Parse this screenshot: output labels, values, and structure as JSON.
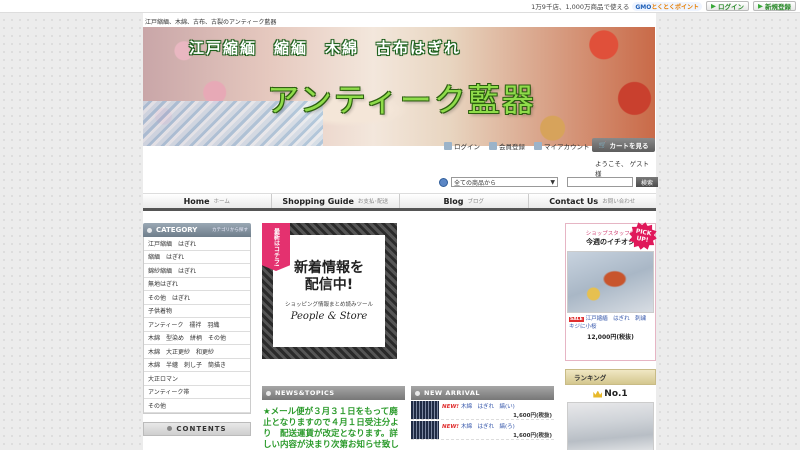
{
  "topbar": {
    "promo_text": "1万9千店、1,000万商品で使える",
    "gmo_brand": "GMO",
    "gmo_points": "とくとくポイント",
    "login_label": "ログイン",
    "register_label": "新規登録"
  },
  "header": {
    "tagline": "江戸縮緬、木綿、古布、古裂のアンティーク藍器",
    "banner_sub": "江戸縮緬　縮緬　木綿　古布はぎれ",
    "banner_main": "アンティーク藍器"
  },
  "member": {
    "login": "ログイン",
    "register": "会員登録",
    "account": "マイアカウント",
    "cart": "カートを見る",
    "welcome": "ようこそ、 ゲスト 様"
  },
  "search": {
    "select_value": "全ての商品から",
    "button": "検索"
  },
  "nav": [
    {
      "en": "Home",
      "jp": "ホーム"
    },
    {
      "en": "Shopping Guide",
      "jp": "お支払･配送"
    },
    {
      "en": "Blog",
      "jp": "ブログ"
    },
    {
      "en": "Contact Us",
      "jp": "お問い合わせ"
    }
  ],
  "sidebar": {
    "category_title": "CATEGORY",
    "category_sub": "カテゴリから探す",
    "categories": [
      "江戸縮緬　はぎれ",
      "縮緬　はぎれ",
      "錦紗縮緬　はぎれ",
      "無地はぎれ",
      "その他　はぎれ",
      "子供着物",
      "アンティーク　襦袢　羽織",
      "木綿　型染め　絣柄　その他",
      "木綿　大正更紗　和更紗",
      "木綿　半纏　刺し子　筒描き",
      "大正ロマン",
      "アンティーク帯",
      "その他"
    ],
    "contents_title": "CONTENTS"
  },
  "ad": {
    "badge": "最新はコチラ!",
    "line1": "新着情報を",
    "line2": "配信中!",
    "line3": "ショッピング情報まとめ読みツール",
    "brand": "People & Store"
  },
  "news": {
    "title": "NEWS&TOPICS",
    "body": "★メール便が３月３１日をもって廃止となりますので４月１日受注分より　配送運賃が改定となります。詳しい内容が決まり次第お知らせ致し"
  },
  "arrival": {
    "title": "NEW ARRIVAL",
    "items": [
      {
        "new": "NEW!",
        "name": "木綿　はぎれ　縞(い)",
        "price": "1,600円(税抜)"
      },
      {
        "new": "NEW!",
        "name": "木綿　はぎれ　縞(ろ)",
        "price": "1,600円(税抜)"
      }
    ]
  },
  "pickup": {
    "head_small": "ショップスタッフの",
    "head_main": "今週のイチオシ",
    "badge": "PICK UP!",
    "sale": "SALE",
    "name": "江戸縮緬　はぎれ　刺繍　キジに小桜",
    "price": "12,000円(税抜)"
  },
  "ranking": {
    "title": "ランキング",
    "no1": "No.1"
  }
}
